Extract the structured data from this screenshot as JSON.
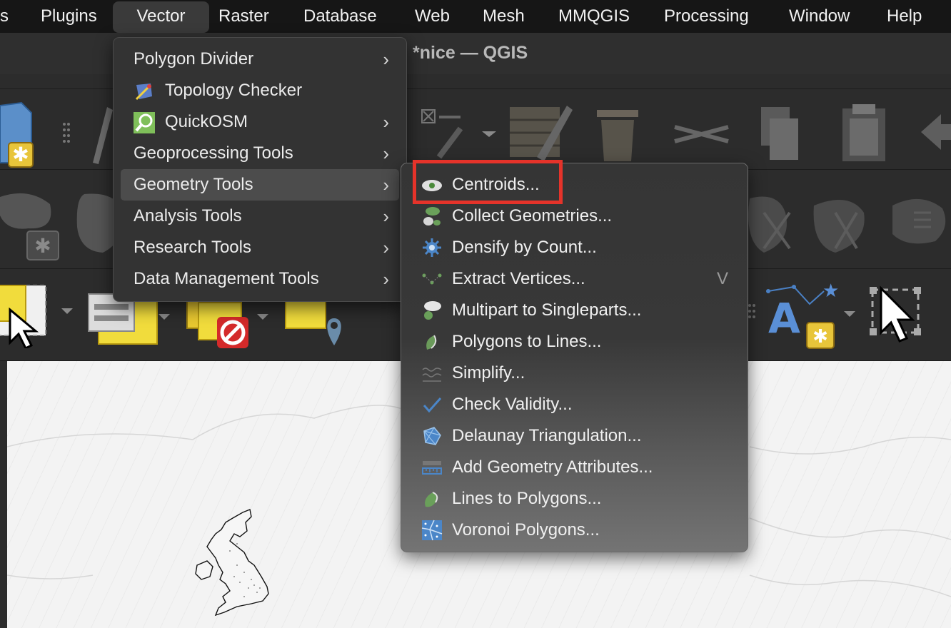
{
  "window": {
    "title": "*nice — QGIS"
  },
  "menubar": {
    "items": [
      {
        "label": "s"
      },
      {
        "label": "Plugins"
      },
      {
        "label": "Vector",
        "active": true
      },
      {
        "label": "Raster"
      },
      {
        "label": "Database"
      },
      {
        "label": "Web"
      },
      {
        "label": "Mesh"
      },
      {
        "label": "MMQGIS"
      },
      {
        "label": "Processing"
      },
      {
        "label": "Window"
      },
      {
        "label": "Help"
      }
    ]
  },
  "vector_menu": {
    "items": [
      {
        "label": "Polygon Divider",
        "submenu": true
      },
      {
        "label": "Topology Checker",
        "icon": "topology-checker-icon"
      },
      {
        "label": "QuickOSM",
        "icon": "quickosm-icon",
        "submenu": true
      },
      {
        "label": "Geoprocessing Tools",
        "submenu": true
      },
      {
        "label": "Geometry Tools",
        "submenu": true,
        "highlighted": true
      },
      {
        "label": "Analysis Tools",
        "submenu": true
      },
      {
        "label": "Research Tools",
        "submenu": true
      },
      {
        "label": "Data Management Tools",
        "submenu": true
      }
    ],
    "arrow_glyph": "›"
  },
  "geometry_submenu": {
    "items": [
      {
        "label": "Centroids...",
        "icon": "centroids-icon"
      },
      {
        "label": "Collect Geometries...",
        "icon": "collect-geometries-icon"
      },
      {
        "label": "Densify by Count...",
        "icon": "densify-icon"
      },
      {
        "label": "Extract Vertices...",
        "icon": "extract-vertices-icon",
        "shortcut": "V"
      },
      {
        "label": "Multipart to Singleparts...",
        "icon": "multipart-icon"
      },
      {
        "label": "Polygons to Lines...",
        "icon": "polygons-to-lines-icon"
      },
      {
        "label": "Simplify...",
        "icon": "simplify-icon"
      },
      {
        "label": "Check Validity...",
        "icon": "check-validity-icon"
      },
      {
        "label": "Delaunay Triangulation...",
        "icon": "delaunay-icon"
      },
      {
        "label": "Add Geometry Attributes...",
        "icon": "geometry-attributes-icon"
      },
      {
        "label": "Lines to Polygons...",
        "icon": "lines-to-polygons-icon"
      },
      {
        "label": "Voronoi Polygons...",
        "icon": "voronoi-icon"
      }
    ]
  },
  "colors": {
    "highlight_box": "#e5332a",
    "menu_bg": "#333333",
    "menubar_bg": "#161616"
  }
}
